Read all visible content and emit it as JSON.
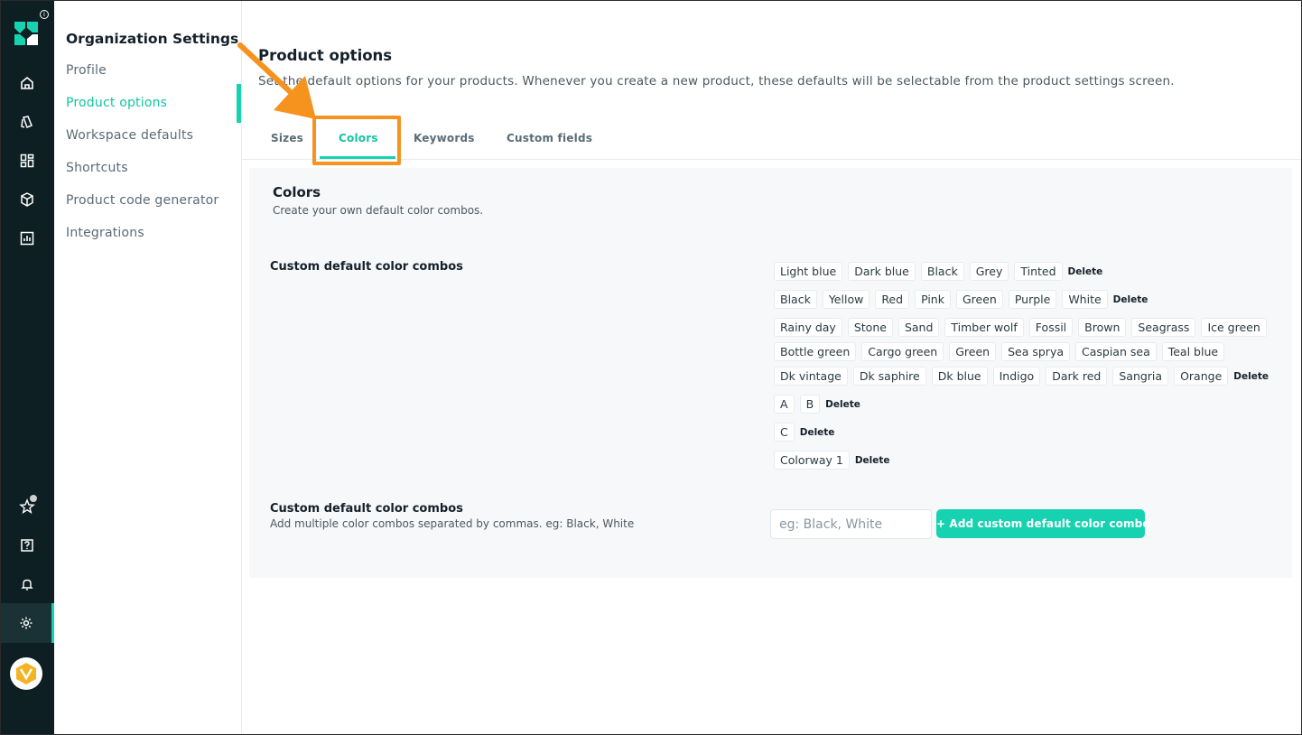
{
  "sidebar": {
    "title": "Organization Settings",
    "items": [
      {
        "label": "Profile"
      },
      {
        "label": "Product options"
      },
      {
        "label": "Workspace defaults"
      },
      {
        "label": "Shortcuts"
      },
      {
        "label": "Product code generator"
      },
      {
        "label": "Integrations"
      }
    ],
    "active": "Product options"
  },
  "rail": {
    "icons": [
      "logo-icon",
      "info-icon",
      "home-icon",
      "tag-icon",
      "dashboard-icon",
      "box-icon",
      "chart-icon",
      "star-icon",
      "help-icon",
      "bell-icon",
      "gear-icon",
      "avatar"
    ]
  },
  "main": {
    "title": "Product options",
    "description": "Set the default options for your products. Whenever you create a new product, these defaults will be selectable from the product settings screen.",
    "tabs": [
      {
        "label": "Sizes"
      },
      {
        "label": "Colors"
      },
      {
        "label": "Keywords"
      },
      {
        "label": "Custom fields"
      }
    ],
    "active_tab": "Colors"
  },
  "colors": {
    "title": "Colors",
    "subtitle": "Create your own default color combos.",
    "combos_label": "Custom default color combos",
    "delete_label": "Delete",
    "combos": [
      [
        "Light blue",
        "Dark blue",
        "Black",
        "Grey",
        "Tinted"
      ],
      [
        "Black",
        "Yellow",
        "Red",
        "Pink",
        "Green",
        "Purple",
        "White"
      ],
      [
        "Rainy day",
        "Stone",
        "Sand",
        "Timber wolf",
        "Fossil",
        "Brown",
        "Seagrass",
        "Ice green",
        "Bottle green",
        "Cargo green",
        "Green",
        "Sea sprya",
        "Caspian sea",
        "Teal blue",
        "Dk vintage",
        "Dk saphire",
        "Dk blue",
        "Indigo",
        "Dark red",
        "Sangria",
        "Orange"
      ],
      [
        "A",
        "B"
      ],
      [
        "C"
      ],
      [
        "Colorway 1"
      ]
    ],
    "add": {
      "label": "Custom default color combos",
      "hint": "Add multiple color combos separated by commas. eg: Black, White",
      "placeholder": "eg: Black, White",
      "button": "+ Add custom default color combo"
    }
  },
  "colors_theme": {
    "accent": "#17d2b0",
    "rail_bg": "#0e1f24",
    "highlight": "#f6921e"
  }
}
